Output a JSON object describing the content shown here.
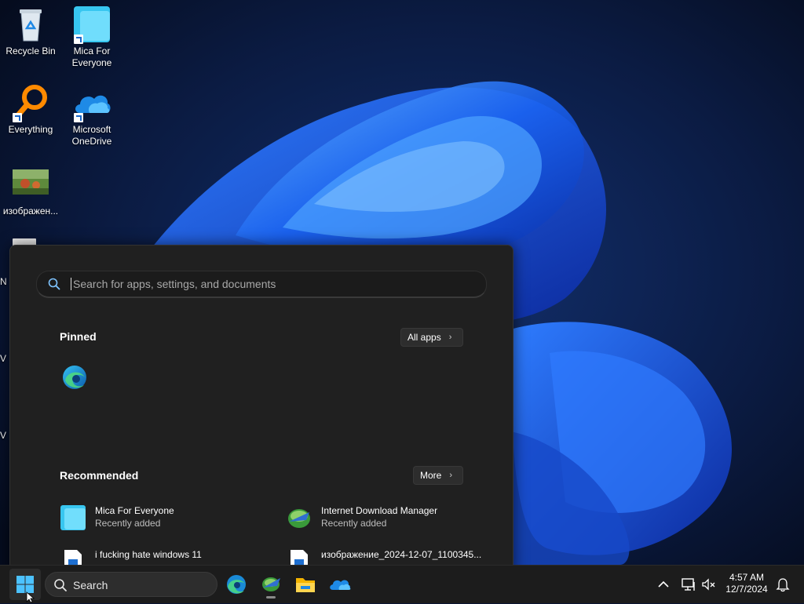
{
  "desktop": {
    "icons": [
      {
        "label": "Recycle Bin",
        "icon": "recycle-bin-icon"
      },
      {
        "label": "Mica For\nEveryone",
        "icon": "mica-icon"
      },
      {
        "label": "Everything",
        "icon": "everything-search-icon"
      },
      {
        "label": "Microsoft\nOneDrive",
        "icon": "onedrive-icon"
      },
      {
        "label": "изображен...",
        "icon": "image-thumbnail-icon"
      }
    ],
    "partial_labels": [
      "N",
      "V",
      "V"
    ]
  },
  "start_menu": {
    "search_placeholder": "Search for apps, settings, and documents",
    "pinned_title": "Pinned",
    "all_apps_label": "All apps",
    "pinned_apps": [
      {
        "icon": "edge-icon"
      }
    ],
    "recommended_title": "Recommended",
    "more_label": "More",
    "recommended": [
      {
        "name": "Mica For Everyone",
        "sub": "Recently added",
        "icon": "mica-icon"
      },
      {
        "name": "Internet Download Manager",
        "sub": "Recently added",
        "icon": "idm-icon"
      },
      {
        "name": "i fucking hate windows 11",
        "sub": "",
        "icon": "image-file-icon"
      },
      {
        "name": "изображение_2024-12-07_1100345...",
        "sub": "",
        "icon": "image-file-icon"
      }
    ]
  },
  "taskbar": {
    "search_label": "Search",
    "apps": [
      "edge-icon",
      "idm-icon",
      "file-explorer-icon",
      "onedrive-icon"
    ],
    "time": "4:57 AM",
    "date": "12/7/2024",
    "tray": [
      "chevron-up-icon",
      "network-icon",
      "volume-muted-icon",
      "notification-bell-icon"
    ]
  },
  "colors": {
    "accent": "#0078d4",
    "start_bg": "#202020",
    "taskbar_bg": "#1c1c1c"
  }
}
